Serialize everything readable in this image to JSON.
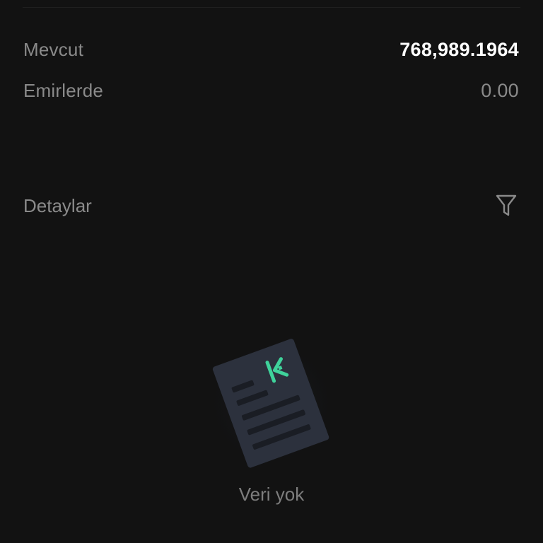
{
  "balances": {
    "available": {
      "label": "Mevcut",
      "value": "768,989.1964"
    },
    "in_orders": {
      "label": "Emirlerde",
      "value": "0.00"
    }
  },
  "details": {
    "label": "Detaylar",
    "filter_icon": "filter-icon"
  },
  "empty_state": {
    "text": "Veri yok",
    "icon": "empty-document-icon"
  },
  "colors": {
    "background": "#121212",
    "label": "#8a8a8a",
    "value": "#ffffff",
    "accent": "#3fd39b",
    "doc": "#2c313d"
  }
}
